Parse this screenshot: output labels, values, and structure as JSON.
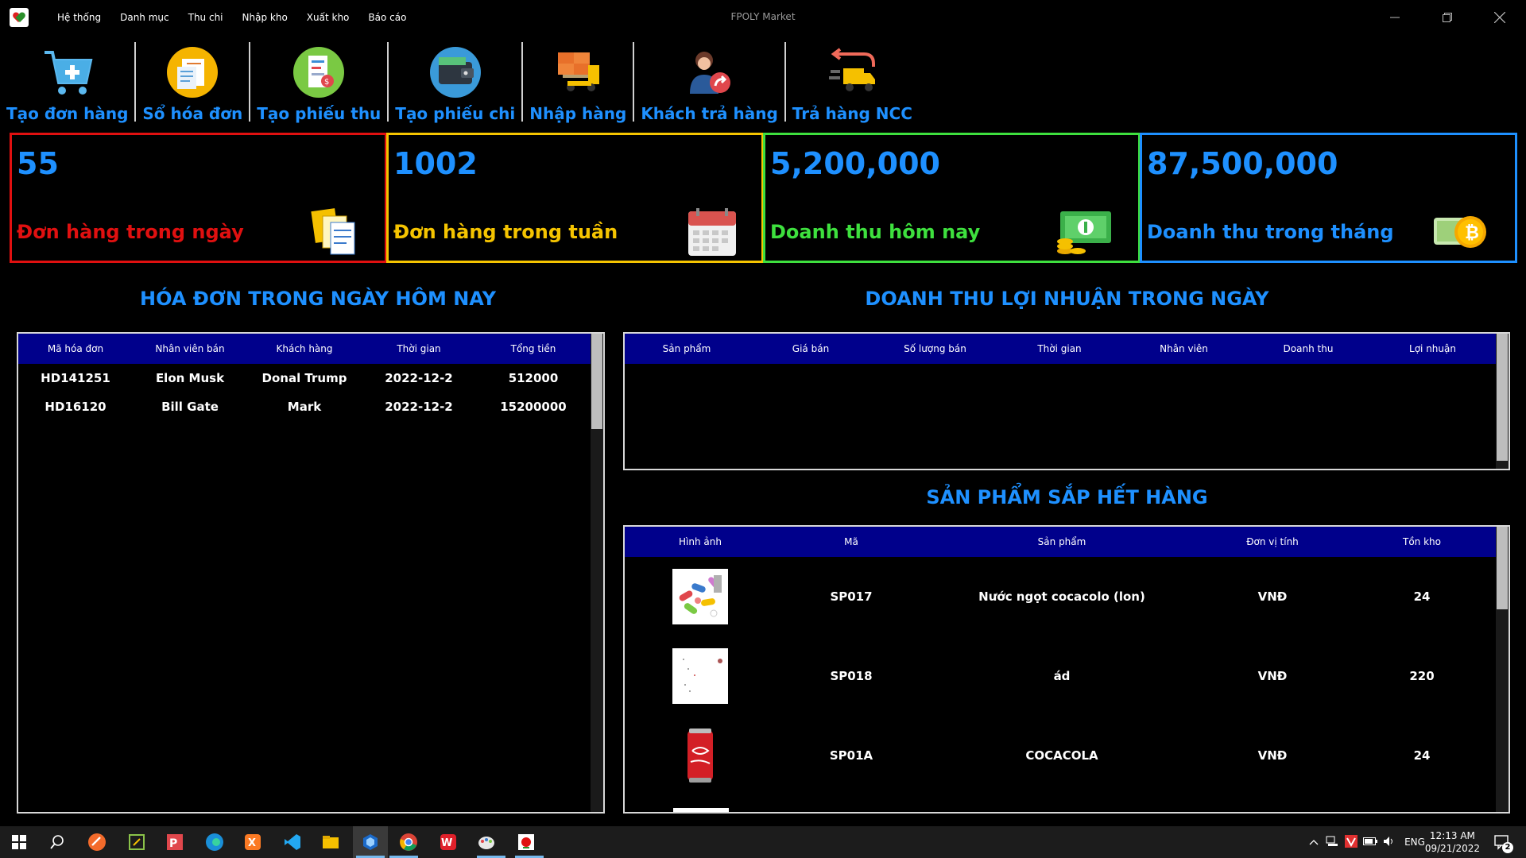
{
  "window": {
    "title": "FPOLY Market"
  },
  "menu": [
    "Hệ thống",
    "Danh mục",
    "Thu chi",
    "Nhập kho",
    "Xuất kho",
    "Báo cáo"
  ],
  "toolbar": [
    {
      "label": "Tạo đơn hàng",
      "icon": "cart-add-icon"
    },
    {
      "label": "Sổ hóa đơn",
      "icon": "invoice-book-icon"
    },
    {
      "label": "Tạo phiếu thu",
      "icon": "receipt-icon"
    },
    {
      "label": "Tạo phiếu chi",
      "icon": "wallet-icon"
    },
    {
      "label": "Nhập hàng",
      "icon": "forklift-icon"
    },
    {
      "label": "Khách trả hàng",
      "icon": "customer-return-icon"
    },
    {
      "label": "Trả hàng NCC",
      "icon": "truck-return-icon"
    }
  ],
  "stats": [
    {
      "value": "55",
      "caption": "Đơn hàng trong ngày",
      "color": "#e01010",
      "icon": "documents-icon"
    },
    {
      "value": "1002",
      "caption": "Đơn hàng trong tuần",
      "color": "#f5c400",
      "icon": "calendar-icon"
    },
    {
      "value": "5,200,000",
      "caption": "Doanh thu hôm nay",
      "color": "#3ee03e",
      "icon": "money-icon"
    },
    {
      "value": "87,500,000",
      "caption": "Doanh thu trong tháng",
      "color": "#1e90ff",
      "icon": "bitcoin-icon"
    }
  ],
  "invoices": {
    "title": "HÓA ĐƠN TRONG NGÀY HÔM NAY",
    "columns": [
      "Mã hóa đơn",
      "Nhân viên bán",
      "Khách hàng",
      "Thời gian",
      "Tổng tiền"
    ],
    "rows": [
      [
        "HD141251",
        "Elon Musk",
        "Donal Trump",
        "2022-12-2",
        "512000"
      ],
      [
        "HD16120",
        "Bill Gate",
        "Mark",
        "2022-12-2",
        "15200000"
      ]
    ]
  },
  "profit": {
    "title": "DOANH THU LỢI NHUẬN TRONG NGÀY",
    "columns": [
      "Sản phẩm",
      "Giá bán",
      "Số lượng bán",
      "Thời gian",
      "Nhân viên",
      "Doanh thu",
      "Lợi nhuận"
    ],
    "rows": []
  },
  "low_stock": {
    "title": "SẢN PHẨM SẮP HẾT HÀNG",
    "columns": [
      "Hình ảnh",
      "Mã",
      "Sản phẩm",
      "Đơn vị tính",
      "Tồn kho"
    ],
    "rows": [
      {
        "image": "pills-image",
        "code": "SP017",
        "name": "Nước ngọt cocacolo (lon)",
        "unit": "VNĐ",
        "stock": "24"
      },
      {
        "image": "blank-image",
        "code": "SP018",
        "name": "ád",
        "unit": "VNĐ",
        "stock": "220"
      },
      {
        "image": "coca-can-image",
        "code": "SP01A",
        "name": "COCACOLA",
        "unit": "VNĐ",
        "stock": "24"
      }
    ]
  },
  "taskbar": {
    "apps": [
      "windows-start-icon",
      "search-icon",
      "brave-icon",
      "snip-icon",
      "jetbrains-icon",
      "edge-icon",
      "xampp-icon",
      "vscode-icon",
      "file-explorer-icon",
      "netbeans-icon",
      "chrome-icon",
      "wps-icon",
      "paint-icon",
      "fpoly-app-icon"
    ],
    "lang": "ENG",
    "time": "12:13 AM",
    "date": "09/21/2022",
    "notifications": "2"
  }
}
